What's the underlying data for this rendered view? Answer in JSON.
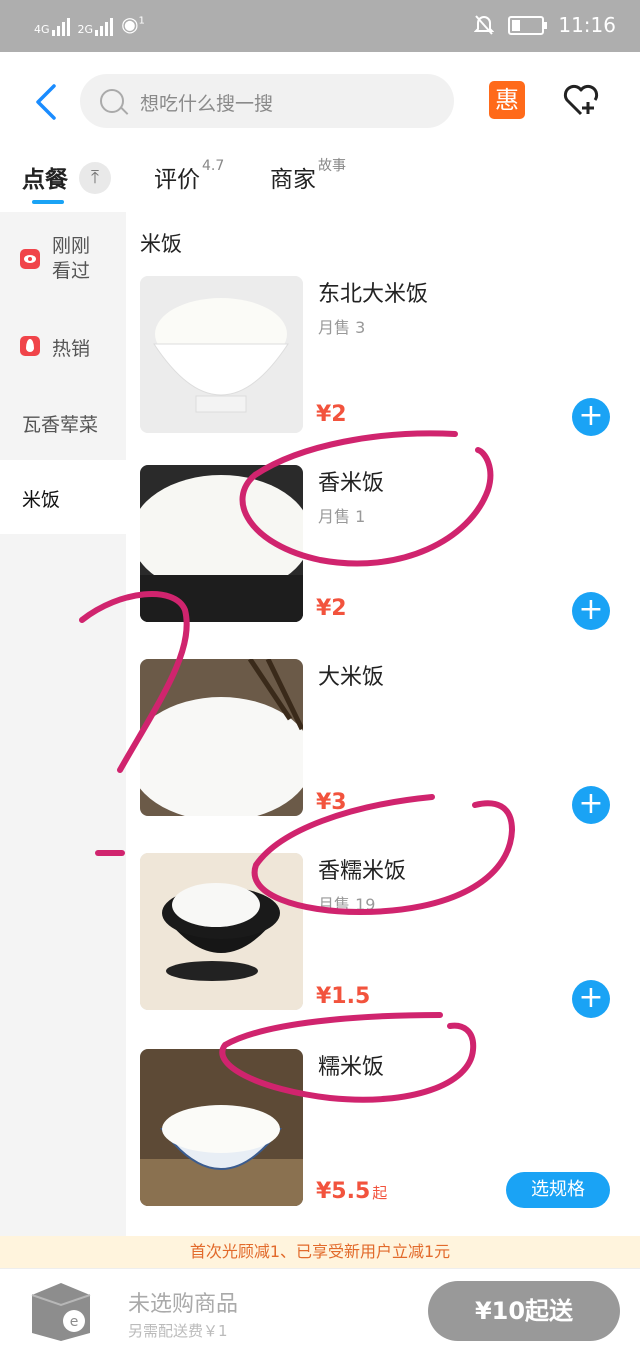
{
  "status_bar": {
    "net1": "4G",
    "net2": "2G",
    "hotspot_badge": "1",
    "time": "11:16"
  },
  "search": {
    "placeholder": "想吃什么搜一搜"
  },
  "header": {
    "coupon_icon_text": "惠"
  },
  "tabs": [
    {
      "label": "点餐",
      "extra": ""
    },
    {
      "label": "评价",
      "extra": "4.7"
    },
    {
      "label": "商家",
      "extra": "故事"
    }
  ],
  "sidebar": {
    "items": [
      {
        "label": "刚刚\n看过",
        "icon": "eye-icon"
      },
      {
        "label": "热销",
        "icon": "flame-icon"
      },
      {
        "label": "瓦香荤菜",
        "icon": ""
      },
      {
        "label": "米饭",
        "icon": "",
        "active": true
      }
    ]
  },
  "section": {
    "title": "米饭"
  },
  "foods": [
    {
      "name": "东北大米饭",
      "sales": "月售 3",
      "price": "¥2",
      "price_suffix": "",
      "action": "add"
    },
    {
      "name": "香米饭",
      "sales": "月售 1",
      "price": "¥2",
      "price_suffix": "",
      "action": "add"
    },
    {
      "name": "大米饭",
      "sales": "",
      "price": "¥3",
      "price_suffix": "",
      "action": "add"
    },
    {
      "name": "香糯米饭",
      "sales": "月售 19",
      "price": "¥1.5",
      "price_suffix": "",
      "action": "add"
    },
    {
      "name": "糯米饭",
      "sales": "",
      "price": "¥5.5",
      "price_suffix": "起",
      "action": "spec",
      "spec_label": "选规格"
    }
  ],
  "promo": {
    "text": "首次光顾减1、已享受新用户立减1元"
  },
  "cart": {
    "empty_text": "未选购商品",
    "delivery_text": "另需配送费￥1",
    "min_order_button": "¥10起送"
  },
  "colors": {
    "accent": "#1aa3f5",
    "price": "#f2533d",
    "coupon": "#ff6a1a",
    "annotation": "#d0246e"
  }
}
